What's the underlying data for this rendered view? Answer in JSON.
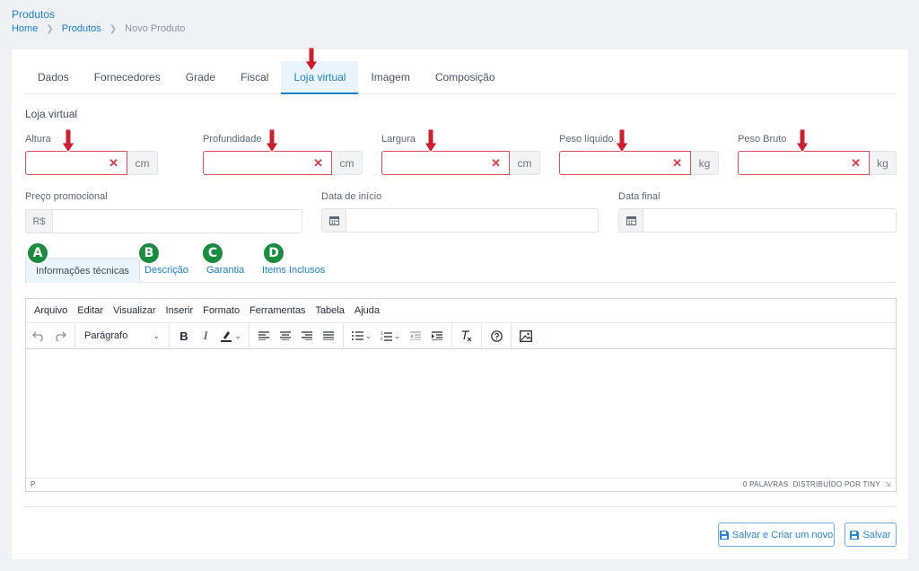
{
  "page": {
    "title": "Produtos",
    "breadcrumb": [
      "Home",
      "Produtos",
      "Novo Produto"
    ]
  },
  "tabs": [
    "Dados",
    "Fornecedores",
    "Grade",
    "Fiscal",
    "Loja virtual",
    "Imagem",
    "Composição"
  ],
  "active_tab": "Loja virtual",
  "section_title": "Loja virtual",
  "dimensions": [
    {
      "label": "Altura",
      "value": "",
      "unit": "cm"
    },
    {
      "label": "Profundidade",
      "value": "",
      "unit": "cm"
    },
    {
      "label": "Largura",
      "value": "",
      "unit": "cm"
    },
    {
      "label": "Peso líquido",
      "value": "",
      "unit": "kg"
    },
    {
      "label": "Peso Bruto",
      "value": "",
      "unit": "kg"
    }
  ],
  "pricing": {
    "promo_label": "Preço promocional",
    "currency": "R$",
    "start_label": "Data de início",
    "end_label": "Data final"
  },
  "subtabs": [
    {
      "badge": "A",
      "label": "Informações técnicas"
    },
    {
      "badge": "B",
      "label": "Descrição"
    },
    {
      "badge": "C",
      "label": "Garantia"
    },
    {
      "badge": "D",
      "label": "Items Inclusos"
    }
  ],
  "editor": {
    "menu": [
      "Arquivo",
      "Editar",
      "Visualizar",
      "Inserir",
      "Formato",
      "Ferramentas",
      "Tabela",
      "Ajuda"
    ],
    "block_format": "Parágrafo",
    "status_path": "P",
    "word_count": "0 PALAVRAS",
    "powered_by": "DISTRIBUÍDO POR TINY"
  },
  "buttons": {
    "save_and_new": "Salvar e Criar um novo",
    "save": "Salvar"
  },
  "colors": {
    "accent": "#1d7fc9",
    "error": "#e34d5a",
    "arrow": "#c8202e",
    "badge": "#1b8b3f"
  }
}
